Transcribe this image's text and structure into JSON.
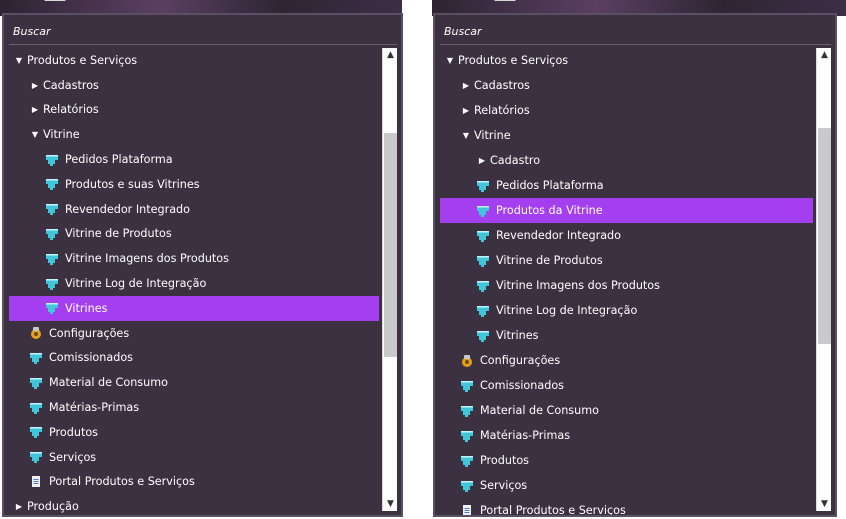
{
  "left": {
    "search_placeholder": "Buscar",
    "rows": [
      {
        "label": "Produtos e Serviços",
        "level": 0,
        "toggle": "down",
        "icon": "none"
      },
      {
        "label": "Cadastros",
        "level": 1,
        "toggle": "right",
        "icon": "none"
      },
      {
        "label": "Relatórios",
        "level": 1,
        "toggle": "right",
        "icon": "none"
      },
      {
        "label": "Vitrine",
        "level": 1,
        "toggle": "down",
        "icon": "none"
      },
      {
        "label": "Pedidos Plataforma",
        "level": 2,
        "toggle": "",
        "icon": "module"
      },
      {
        "label": "Produtos e suas Vitrines",
        "level": 2,
        "toggle": "",
        "icon": "module"
      },
      {
        "label": "Revendedor Integrado",
        "level": 2,
        "toggle": "",
        "icon": "module"
      },
      {
        "label": "Vitrine de Produtos",
        "level": 2,
        "toggle": "",
        "icon": "module"
      },
      {
        "label": "Vitrine Imagens dos Produtos",
        "level": 2,
        "toggle": "",
        "icon": "module"
      },
      {
        "label": "Vitrine Log de Integração",
        "level": 2,
        "toggle": "",
        "icon": "module"
      },
      {
        "label": "Vitrines",
        "level": 2,
        "toggle": "",
        "icon": "module",
        "selected": true
      },
      {
        "label": "Configurações",
        "level": 1,
        "toggle": "",
        "icon": "gear"
      },
      {
        "label": "Comissionados",
        "level": 1,
        "toggle": "",
        "icon": "module"
      },
      {
        "label": "Material de Consumo",
        "level": 1,
        "toggle": "",
        "icon": "module"
      },
      {
        "label": "Matérias-Primas",
        "level": 1,
        "toggle": "",
        "icon": "module"
      },
      {
        "label": "Produtos",
        "level": 1,
        "toggle": "",
        "icon": "module"
      },
      {
        "label": "Serviços",
        "level": 1,
        "toggle": "",
        "icon": "module"
      },
      {
        "label": "Portal Produtos e Serviços",
        "level": 1,
        "toggle": "",
        "icon": "document"
      },
      {
        "label": "Produção",
        "level": 0,
        "toggle": "right",
        "icon": "none"
      }
    ]
  },
  "right": {
    "search_placeholder": "Buscar",
    "rows": [
      {
        "label": "Produtos e Serviços",
        "level": 0,
        "toggle": "down",
        "icon": "none"
      },
      {
        "label": "Cadastros",
        "level": 1,
        "toggle": "right",
        "icon": "none"
      },
      {
        "label": "Relatórios",
        "level": 1,
        "toggle": "right",
        "icon": "none"
      },
      {
        "label": "Vitrine",
        "level": 1,
        "toggle": "down",
        "icon": "none"
      },
      {
        "label": "Cadastro",
        "level": 2,
        "toggle": "right",
        "icon": "none"
      },
      {
        "label": "Pedidos Plataforma",
        "level": 2,
        "toggle": "",
        "icon": "module"
      },
      {
        "label": "Produtos da Vitrine",
        "level": 2,
        "toggle": "",
        "icon": "module",
        "selected": true
      },
      {
        "label": "Revendedor Integrado",
        "level": 2,
        "toggle": "",
        "icon": "module"
      },
      {
        "label": "Vitrine de Produtos",
        "level": 2,
        "toggle": "",
        "icon": "module"
      },
      {
        "label": "Vitrine Imagens dos Produtos",
        "level": 2,
        "toggle": "",
        "icon": "module"
      },
      {
        "label": "Vitrine Log de Integração",
        "level": 2,
        "toggle": "",
        "icon": "module"
      },
      {
        "label": "Vitrines",
        "level": 2,
        "toggle": "",
        "icon": "module"
      },
      {
        "label": "Configurações",
        "level": 1,
        "toggle": "",
        "icon": "gear"
      },
      {
        "label": "Comissionados",
        "level": 1,
        "toggle": "",
        "icon": "module"
      },
      {
        "label": "Material de Consumo",
        "level": 1,
        "toggle": "",
        "icon": "module"
      },
      {
        "label": "Matérias-Primas",
        "level": 1,
        "toggle": "",
        "icon": "module"
      },
      {
        "label": "Produtos",
        "level": 1,
        "toggle": "",
        "icon": "module"
      },
      {
        "label": "Serviços",
        "level": 1,
        "toggle": "",
        "icon": "module"
      },
      {
        "label": "Portal Produtos e Serviços",
        "level": 1,
        "toggle": "",
        "icon": "document"
      }
    ]
  },
  "colors": {
    "panel_bg": "#3b3140",
    "selection": "#a43ff0",
    "module_icon": "#41c6d9"
  }
}
